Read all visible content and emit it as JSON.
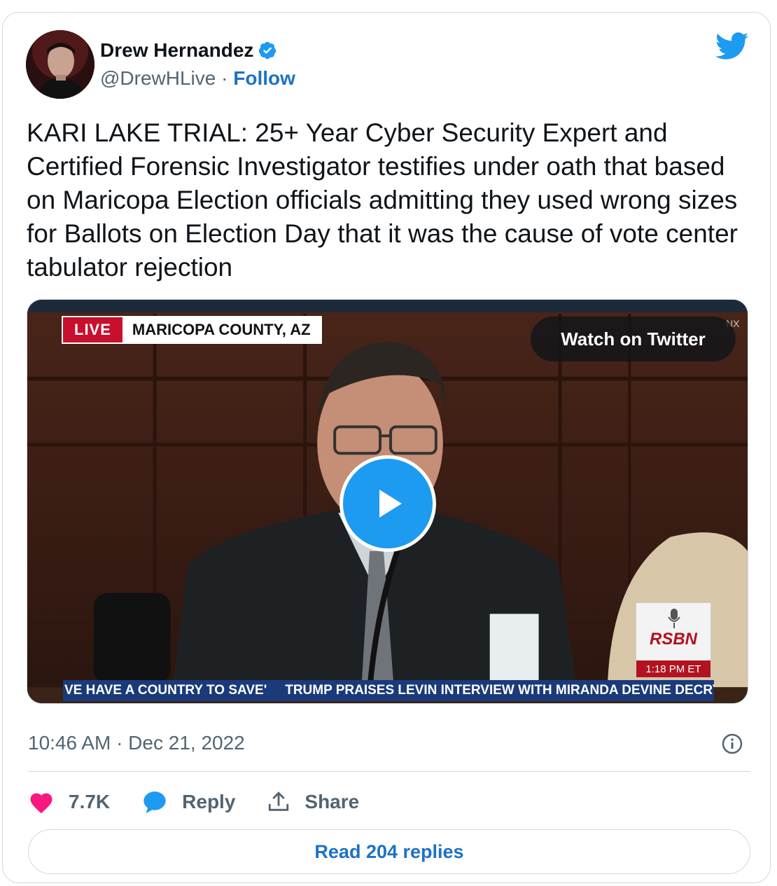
{
  "author": {
    "name": "Drew Hernandez",
    "handle": "@DrewHLive",
    "separator": " · ",
    "follow_label": "Follow",
    "verified": true
  },
  "tweet": {
    "text": "KARI LAKE TRIAL: 25+ Year Cyber Security Expert and Certified Forensic Investigator testifies under oath that based on Maricopa Election officials admitting they used wrong sizes for Ballots on Election Day that it was the cause of vote center tabulator rejection",
    "timestamp": "10:46 AM · Dec 21, 2022"
  },
  "video": {
    "live_label": "LIVE",
    "location_label": "MARICOPA COUNTY, AZ",
    "watch_label": "Watch on Twitter",
    "rsbn_logo": "RSBN",
    "rsbn_time": "1:18 PM  ET",
    "ticker_left": "VE HAVE A COUNTRY TO SAVE'",
    "ticker_right": "TRUMP PRAISES LEVIN INTERVIEW WITH MIRANDA DEVINE DECRY",
    "corner_mark": "NX"
  },
  "actions": {
    "like_count": "7.7K",
    "reply_label": "Reply",
    "share_label": "Share"
  },
  "read_replies_label": "Read 204 replies",
  "colors": {
    "like": "#f91880",
    "link_blue": "#1d72c6",
    "twitter_blue": "#1d9bf0",
    "muted": "#536471"
  }
}
